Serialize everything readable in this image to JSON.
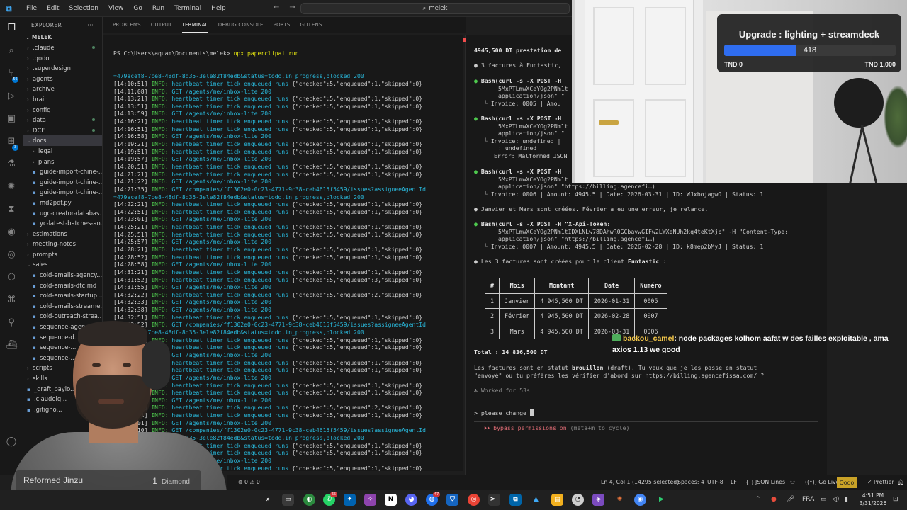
{
  "titlebar": {
    "menu": [
      "File",
      "Edit",
      "Selection",
      "View",
      "Go",
      "Run",
      "Terminal",
      "Help"
    ],
    "search": "melek"
  },
  "sidebar": {
    "header": "EXPLORER",
    "root": "MELEK",
    "items": [
      {
        "label": ".claude",
        "type": "folder",
        "indent": 1,
        "dot": true
      },
      {
        "label": ".qodo",
        "type": "folder",
        "indent": 1
      },
      {
        "label": ".superdesign",
        "type": "folder",
        "indent": 1
      },
      {
        "label": "agents",
        "type": "folder",
        "indent": 1
      },
      {
        "label": "archive",
        "type": "folder",
        "indent": 1
      },
      {
        "label": "brain",
        "type": "folder",
        "indent": 1
      },
      {
        "label": "config",
        "type": "folder",
        "indent": 1
      },
      {
        "label": "data",
        "type": "folder",
        "indent": 1,
        "dot": true
      },
      {
        "label": "DCE",
        "type": "folder",
        "indent": 1,
        "dot": true
      },
      {
        "label": "docs",
        "type": "folder-open",
        "indent": 1,
        "selected": true
      },
      {
        "label": "legal",
        "type": "folder",
        "indent": 2
      },
      {
        "label": "plans",
        "type": "folder",
        "indent": 2
      },
      {
        "label": "guide-import-chine-...",
        "type": "file",
        "indent": 2
      },
      {
        "label": "guide-import-chine-...",
        "type": "file",
        "indent": 2
      },
      {
        "label": "guide-import-chine-...",
        "type": "file",
        "indent": 2
      },
      {
        "label": "md2pdf.py",
        "type": "file",
        "indent": 2
      },
      {
        "label": "ugc-creator-databas...",
        "type": "file",
        "indent": 2
      },
      {
        "label": "yc-latest-batches-an...",
        "type": "file",
        "indent": 2
      },
      {
        "label": "estimations",
        "type": "folder",
        "indent": 1
      },
      {
        "label": "meeting-notes",
        "type": "folder",
        "indent": 1
      },
      {
        "label": "prompts",
        "type": "folder",
        "indent": 1
      },
      {
        "label": "sales",
        "type": "folder-open",
        "indent": 1
      },
      {
        "label": "cold-emails-agency...",
        "type": "file",
        "indent": 2
      },
      {
        "label": "cold-emails-dtc.md",
        "type": "file",
        "indent": 2
      },
      {
        "label": "cold-emails-startup...",
        "type": "file",
        "indent": 2
      },
      {
        "label": "cold-emails-streame...",
        "type": "file",
        "indent": 2
      },
      {
        "label": "cold-outreach-strea...",
        "type": "file",
        "indent": 2
      },
      {
        "label": "sequence-agen...",
        "type": "file",
        "indent": 2
      },
      {
        "label": "sequence-d...",
        "type": "file",
        "indent": 2
      },
      {
        "label": "sequence-...",
        "type": "file",
        "indent": 2
      },
      {
        "label": "sequence-...",
        "type": "file",
        "indent": 2
      },
      {
        "label": "scripts",
        "type": "folder",
        "indent": 1
      },
      {
        "label": "skills",
        "type": "folder",
        "indent": 1
      },
      {
        "label": "_draft_paylo...",
        "type": "file",
        "indent": 1
      },
      {
        "label": ".claudeig...",
        "type": "file",
        "indent": 1
      },
      {
        "label": ".gitigno...",
        "type": "file",
        "indent": 1
      }
    ]
  },
  "panel": {
    "tabs": [
      "PROBLEMS",
      "OUTPUT",
      "TERMINAL",
      "DEBUG CONSOLE",
      "PORTS",
      "GITLENS"
    ],
    "active_tab": "TERMINAL"
  },
  "terminal_left": {
    "prompt": "PS C:\\Users\\aquam\\Documents\\melek> ",
    "command": "npx paperclipai run",
    "lines": [
      {
        "k": "url",
        "t": "=479acef8-7ce8-48df-8d35-3ele82f84edb&status=todo,in_progress,blocked 200"
      },
      {
        "k": "hb",
        "ts": "[14:10:51]",
        "t": "heartbeat timer tick enqueued runs ",
        "j": "{\"checked\":5,\"enqueued\":1,\"skipped\":0}"
      },
      {
        "k": "get",
        "ts": "[14:11:08]",
        "t": "/agents/me/inbox-lite 200"
      },
      {
        "k": "hb",
        "ts": "[14:13:21]",
        "t": "heartbeat timer tick enqueued runs ",
        "j": "{\"checked\":5,\"enqueued\":1,\"skipped\":0}"
      },
      {
        "k": "hb",
        "ts": "[14:13:51]",
        "t": "heartbeat timer tick enqueued runs ",
        "j": "{\"checked\":5,\"enqueued\":1,\"skipped\":0}"
      },
      {
        "k": "get",
        "ts": "[14:13:59]",
        "t": "/agents/me/inbox-lite 200"
      },
      {
        "k": "hb",
        "ts": "[14:16:21]",
        "t": "heartbeat timer tick enqueued runs ",
        "j": "{\"checked\":5,\"enqueued\":1,\"skipped\":0}"
      },
      {
        "k": "hb",
        "ts": "[14:16:51]",
        "t": "heartbeat timer tick enqueued runs ",
        "j": "{\"checked\":5,\"enqueued\":1,\"skipped\":0}"
      },
      {
        "k": "get",
        "ts": "[14:16:58]",
        "t": "/agents/me/inbox-lite 200"
      },
      {
        "k": "hb",
        "ts": "[14:19:21]",
        "t": "heartbeat timer tick enqueued runs ",
        "j": "{\"checked\":5,\"enqueued\":1,\"skipped\":0}"
      },
      {
        "k": "hb",
        "ts": "[14:19:51]",
        "t": "heartbeat timer tick enqueued runs ",
        "j": "{\"checked\":5,\"enqueued\":1,\"skipped\":0}"
      },
      {
        "k": "get",
        "ts": "[14:19:57]",
        "t": "/agents/me/inbox-lite 200"
      },
      {
        "k": "hb",
        "ts": "[14:20:51]",
        "t": "heartbeat timer tick enqueued runs ",
        "j": "{\"checked\":5,\"enqueued\":1,\"skipped\":0}"
      },
      {
        "k": "hb",
        "ts": "[14:21:21]",
        "t": "heartbeat timer tick enqueued runs ",
        "j": "{\"checked\":5,\"enqueued\":1,\"skipped\":0}"
      },
      {
        "k": "get",
        "ts": "[14:21:22]",
        "t": "/agents/me/inbox-lite 200"
      },
      {
        "k": "get",
        "ts": "[14:21:35]",
        "t": "/companies/ff1302e0-0c23-4771-9c38-ceb4615f5459/issues?assigneeAgentId"
      },
      {
        "k": "url",
        "t": "=479acef8-7ce8-48df-8d35-3ele82f84edb&status=todo,in_progress,blocked 200"
      },
      {
        "k": "hb",
        "ts": "[14:22:21]",
        "t": "heartbeat timer tick enqueued runs ",
        "j": "{\"checked\":5,\"enqueued\":1,\"skipped\":0}"
      },
      {
        "k": "hb",
        "ts": "[14:22:51]",
        "t": "heartbeat timer tick enqueued runs ",
        "j": "{\"checked\":5,\"enqueued\":1,\"skipped\":0}"
      },
      {
        "k": "get",
        "ts": "[14:23:01]",
        "t": "/agents/me/inbox-lite 200"
      },
      {
        "k": "hb",
        "ts": "[14:25:21]",
        "t": "heartbeat timer tick enqueued runs ",
        "j": "{\"checked\":5,\"enqueued\":1,\"skipped\":0}"
      },
      {
        "k": "hb",
        "ts": "[14:25:51]",
        "t": "heartbeat timer tick enqueued runs ",
        "j": "{\"checked\":5,\"enqueued\":1,\"skipped\":0}"
      },
      {
        "k": "get",
        "ts": "[14:25:57]",
        "t": "/agents/me/inbox-lite 200"
      },
      {
        "k": "hb",
        "ts": "[14:28:21]",
        "t": "heartbeat timer tick enqueued runs ",
        "j": "{\"checked\":5,\"enqueued\":1,\"skipped\":0}"
      },
      {
        "k": "hb",
        "ts": "[14:28:52]",
        "t": "heartbeat timer tick enqueued runs ",
        "j": "{\"checked\":5,\"enqueued\":1,\"skipped\":0}"
      },
      {
        "k": "get",
        "ts": "[14:28:58]",
        "t": "/agents/me/inbox-lite 200"
      },
      {
        "k": "hb",
        "ts": "[14:31:21]",
        "t": "heartbeat timer tick enqueued runs ",
        "j": "{\"checked\":5,\"enqueued\":1,\"skipped\":0}"
      },
      {
        "k": "hb",
        "ts": "[14:31:52]",
        "t": "heartbeat timer tick enqueued runs ",
        "j": "{\"checked\":5,\"enqueued\":3,\"skipped\":0}"
      },
      {
        "k": "get",
        "ts": "[14:31:55]",
        "t": "/agents/me/inbox-lite 200"
      },
      {
        "k": "hb",
        "ts": "[14:32:22]",
        "t": "heartbeat timer tick enqueued runs ",
        "j": "{\"checked\":5,\"enqueued\":2,\"skipped\":0}"
      },
      {
        "k": "get",
        "ts": "[14:32:33]",
        "t": "/agents/me/inbox-lite 200"
      },
      {
        "k": "get",
        "ts": "[14:32:38]",
        "t": "/agents/me/inbox-lite 200"
      },
      {
        "k": "hb",
        "ts": "[14:32:51]",
        "t": "heartbeat timer tick enqueued runs ",
        "j": "{\"checked\":5,\"enqueued\":1,\"skipped\":0}"
      },
      {
        "k": "get",
        "ts": "[14:32:52]",
        "t": "/companies/ff1302e0-0c23-4771-9c38-ceb4615f5459/issues?assigneeAgentId"
      },
      {
        "k": "url",
        "t": "=479acef8-7ce8-48df-8d35-3ele82f84edb&status=todo,in_progress,blocked 200"
      },
      {
        "k": "hb",
        "ts": "[14:34:21]",
        "t": "heartbeat timer tick enqueued runs ",
        "j": "{\"checked\":5,\"enqueued\":1,\"skipped\":0}"
      },
      {
        "k": "hb",
        "ts": "[14:34:51]",
        "t": "heartbeat timer tick enqueued runs ",
        "j": "{\"checked\":5,\"enqueued\":1,\"skipped\":0}"
      },
      {
        "k": "get",
        "ts": "[14:34:59]",
        "t": "/agents/me/inbox-lite 200"
      },
      {
        "k": "hb",
        "ts": "[14:37:21]",
        "t": "heartbeat timer tick enqueued runs ",
        "j": "{\"checked\":5,\"enqueued\":1,\"skipped\":0}"
      },
      {
        "k": "hb",
        "ts": "[14:37:51]",
        "t": "heartbeat timer tick enqueued runs ",
        "j": "{\"checked\":5,\"enqueued\":1,\"skipped\":0}"
      },
      {
        "k": "get",
        "ts": "[14:37:59]",
        "t": "/agents/me/inbox-lite 200"
      },
      {
        "k": "hb",
        "ts": "[14:40:21]",
        "t": "heartbeat timer tick enqueued runs ",
        "j": "{\"checked\":5,\"enqueued\":1,\"skipped\":0}"
      },
      {
        "k": "hb",
        "ts": "[14:40:51]",
        "t": "heartbeat timer tick enqueued runs ",
        "j": "{\"checked\":5,\"enqueued\":1,\"skipped\":0}"
      },
      {
        "k": "get",
        "ts": "[14:41:00]",
        "t": "/agents/me/inbox-lite 200"
      },
      {
        "k": "hb",
        "ts": "[14:43:21]",
        "t": "heartbeat timer tick enqueued runs ",
        "j": "{\"checked\":5,\"enqueued\":2,\"skipped\":0}"
      },
      {
        "k": "hb",
        "ts": "[14:43:51]",
        "t": "heartbeat timer tick enqueued runs ",
        "j": "{\"checked\":5,\"enqueued\":1,\"skipped\":0}"
      },
      {
        "k": "get",
        "ts": "[14:44:01]",
        "t": "/agents/me/inbox-lite 200"
      },
      {
        "k": "get",
        "ts": "[14:44:10]",
        "t": "/companies/ff1302e0-0c23-4771-9c38-ceb4615f5459/issues?assigneeAgentId"
      },
      {
        "k": "url",
        "t": "=479acef8-7ce8-48df-8d35-3ele82f84edb&status=todo,in_progress,blocked 200"
      },
      {
        "k": "hb",
        "ts": "[14:46:21]",
        "t": "heartbeat timer tick enqueued runs ",
        "j": "{\"checked\":5,\"enqueued\":1,\"skipped\":0}"
      },
      {
        "k": "hb",
        "ts": "[14:46:51]",
        "t": "heartbeat timer tick enqueued runs ",
        "j": "{\"checked\":5,\"enqueued\":1,\"skipped\":0}"
      },
      {
        "k": "get",
        "ts": "[14:47:01]",
        "t": "/agents/me/inbox-lite 200"
      },
      {
        "k": "hb",
        "ts": "[14:49:21]",
        "t": "heartbeat timer tick enqueued runs ",
        "j": "{\"checked\":5,\"enqueued\":1,\"skipped\":0}"
      },
      {
        "k": "hb",
        "ts": "[14:49:51]",
        "t": "heartbeat timer tick enqueued runs ",
        "j": "{\"checked\":5,\"enqueued\":1,\"skipped\":0}"
      },
      {
        "k": "get",
        "ts": "[14:50:02]",
        "t": "/agents/me/inbox-lite 200"
      }
    ]
  },
  "terminal_right": {
    "l_top": "4945,500 DT prestation de",
    "l_factures": "3 factures à Funtastic,",
    "bash1_a": "Bash(curl -s -X POST -H",
    "bash1_b": "5MxPTLmwXCeYOg2PNm1t",
    "bash1_c": "application/json\" \"",
    "bash1_d": "Invoice: 0005 | Amou",
    "bash2_a": "Bash(curl -s -X POST -H",
    "bash2_b": "5MxPTLmwXCeYOg2PNm1t",
    "bash2_c": "application/json\" \"",
    "bash2_d": "Invoice: undefined |",
    "bash2_e": ": undefined",
    "bash2_f": "Error: Malformed JSON",
    "bash3_a": "Bash(curl -s -X POST -H",
    "bash3_b": "5MxPTLmwXCeYOg2PNm1t",
    "bash3_c": "application/json\" \"https://billing.agencefi…)",
    "bash3_d": "Invoice: 0006 | Amount: 4945.5 | Date: 2026-03-31 | ID: WJxbojagwO | Status: 1",
    "l_jm": "Janvier et Mars sont créées. Février a eu une erreur, je relance.",
    "bash4_a": "Bash(curl -s -X POST -H \"X-Api-Token:",
    "bash4_b": "5MxPTLmwXCeYOg2PNm1tIDXLNLw78DAhwR0GCbavwGIFw2LWXeNUh2kq4teKtXjb\" -H \"Content-Type:",
    "bash4_c": "application/json\" \"https://billing.agencefi…)",
    "bash4_d": "Invoice: 0007 | Amount: 4945.5 | Date: 2026-02-28 | ID: k8mep2bMyJ | Status: 1",
    "l_created_pre": "Les 3 factures sont créées pour le client ",
    "l_created_client": "Funtastic",
    "l_created_post": " :",
    "table": {
      "headers": [
        "#",
        "Mois",
        "Montant",
        "Date",
        "Numéro"
      ],
      "rows": [
        [
          "1",
          "Janvier",
          "4 945,500 DT",
          "2026-01-31",
          "0005"
        ],
        [
          "2",
          "Février",
          "4 945,500 DT",
          "2026-02-28",
          "0007"
        ],
        [
          "3",
          "Mars",
          "4 945,500 DT",
          "2026-03-31",
          "0006"
        ]
      ]
    },
    "total_label": "Total : 14 836,500 DT",
    "status_1": "Les factures sont en statut ",
    "status_bold": "brouillon",
    "status_2": " (draft). Tu veux que je les passe en statut",
    "status_3": "\"envoyé\" ou tu préfères les vérifier d'abord sur https://billing.agencefissa.com/ ?",
    "worked": "✻ Worked for 53s",
    "input_prompt": ">",
    "input_text": "please change ",
    "bypass_icon": "⏵⏵",
    "bypass_text": "bypass permissions on",
    "bypass_hint": " (meta+m to cycle)"
  },
  "upgrade": {
    "title": "Upgrade : lighting + streamdeck",
    "value": "418",
    "progress": 0.418,
    "min": "TND 0",
    "max": "TND 1,000"
  },
  "chat": {
    "user": "backou_camel",
    "message": ": node packages kolhom aafat w des failles exploitable , ama axios 1.13 we good"
  },
  "streamer": {
    "name": "Reformed Jinzu",
    "rank_num": "1",
    "rank": "Diamond"
  },
  "statusbar": {
    "errors": "⊗ 0 ⚠ 0",
    "position": "Ln 4, Col 1 (14295 selected)",
    "spaces": "Spaces: 4",
    "encoding": "UTF-8",
    "eol": "LF",
    "braces": "{ }",
    "language": "JSON Lines",
    "golive": "Go Live",
    "qodo": "Qodo",
    "prettier": "✓ Prettier"
  },
  "taskbar": {
    "lang": "FRA",
    "time": "4:51 PM",
    "date": "3/31/2026",
    "badges": [
      "65",
      "47"
    ]
  },
  "colors": {
    "accent": "#0078d4",
    "info_green": "#4ec94e",
    "cyan": "#29b8db",
    "upgrade_bar": "#2f6df0",
    "qodo": "#c9a227"
  }
}
